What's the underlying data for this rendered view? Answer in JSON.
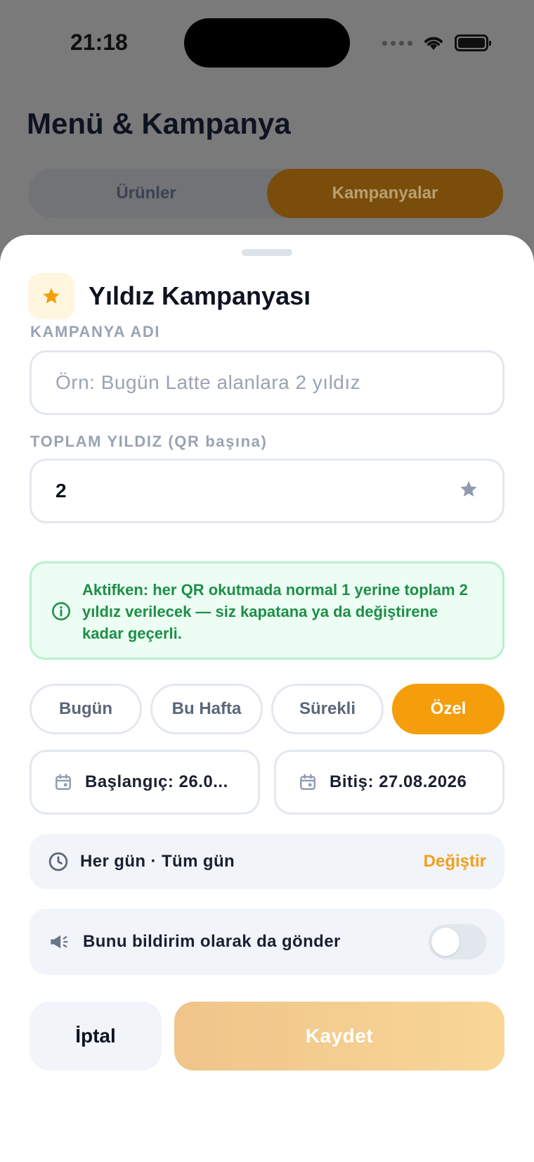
{
  "status_bar": {
    "time": "21:18"
  },
  "background": {
    "title": "Menü & Kampanya",
    "tabs": [
      {
        "label": "Ürünler",
        "active": false
      },
      {
        "label": "Kampanyalar",
        "active": true
      }
    ]
  },
  "sheet": {
    "title": "Yıldız Kampanyası",
    "title_icon": "star-icon",
    "campaign_name": {
      "label": "KAMPANYA ADI",
      "placeholder": "Örn: Bugün Latte alanlara 2 yıldız",
      "value": ""
    },
    "total_stars": {
      "label": "TOPLAM YILDIZ (QR başına)",
      "value": "2",
      "icon": "star-icon"
    },
    "info": {
      "icon": "info-icon",
      "text": "Aktifken: her QR okutmada normal 1 yerine toplam 2 yıldız verilecek — siz kapatana ya da değiştirene kadar geçerli."
    },
    "duration_chips": [
      {
        "label": "Bugün",
        "active": false
      },
      {
        "label": "Bu Hafta",
        "active": false
      },
      {
        "label": "Sürekli",
        "active": false
      },
      {
        "label": "Özel",
        "active": true
      }
    ],
    "start_date": {
      "icon": "calendar-icon",
      "text": "Başlangıç: 26.0..."
    },
    "end_date": {
      "icon": "calendar-icon",
      "text": "Bitiş: 27.08.2026"
    },
    "schedule": {
      "icon": "clock-icon",
      "text": "Her gün · Tüm gün",
      "action": "Değiştir"
    },
    "notification": {
      "icon": "megaphone-icon",
      "text": "Bunu bildirim olarak da gönder",
      "enabled": false
    },
    "buttons": {
      "cancel": "İptal",
      "save": "Kaydet"
    }
  },
  "colors": {
    "accent": "#f59e0b",
    "info_text": "#1e8e48",
    "info_bg": "#ecfdf3",
    "label": "#98a3b4"
  }
}
